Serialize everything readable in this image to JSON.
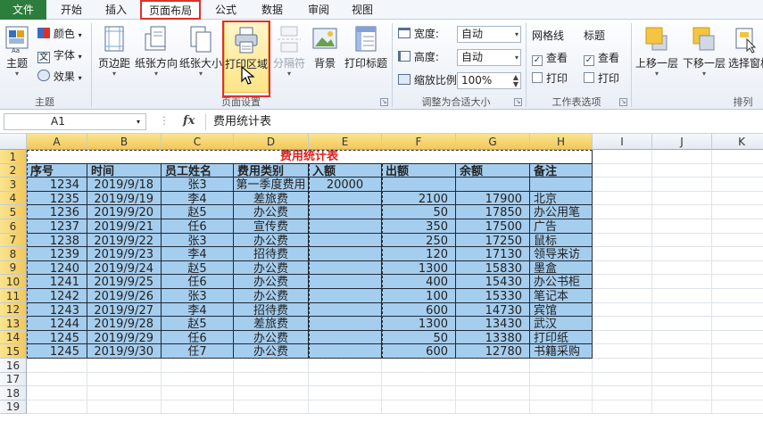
{
  "tabs": [
    {
      "label": "文件"
    },
    {
      "label": "开始"
    },
    {
      "label": "插入"
    },
    {
      "label": "页面布局"
    },
    {
      "label": "公式"
    },
    {
      "label": "数据"
    },
    {
      "label": "审阅"
    },
    {
      "label": "视图"
    }
  ],
  "ribbon": {
    "theme": {
      "theme_label": "主题",
      "colors_label": "颜色",
      "fonts_label": "字体",
      "effects_label": "效果",
      "group_label": "主题"
    },
    "page_setup": {
      "margins_label": "页边距",
      "orientation_label": "纸张方向",
      "size_label": "纸张大小",
      "print_area_label": "打印区域",
      "breaks_label": "分隔符",
      "background_label": "背景",
      "print_titles_label": "打印标题",
      "group_label": "页面设置"
    },
    "scale": {
      "width_label": "宽度:",
      "width_value": "自动",
      "height_label": "高度:",
      "height_value": "自动",
      "scale_label": "缩放比例:",
      "scale_value": "100%",
      "group_label": "调整为合适大小"
    },
    "sheet_options": {
      "gridlines_label": "网格线",
      "headings_label": "标题",
      "view_label": "查看",
      "print_label": "打印",
      "group_label": "工作表选项"
    },
    "arrange": {
      "bring_forward_label": "上移一层",
      "send_backward_label": "下移一层",
      "selection_pane_label": "选择窗格",
      "group_label": "排列"
    }
  },
  "formula_bar": {
    "name_box": "A1",
    "fx": "fx",
    "formula": "费用统计表"
  },
  "columns": [
    "A",
    "B",
    "C",
    "D",
    "E",
    "F",
    "G",
    "H",
    "I",
    "J",
    "K"
  ],
  "rows": [
    "1",
    "2",
    "3",
    "4",
    "5",
    "6",
    "7",
    "8",
    "9",
    "10",
    "11",
    "12",
    "13",
    "14",
    "15",
    "16",
    "17",
    "18",
    "19"
  ],
  "sheet": {
    "title": "费用统计表",
    "headers": [
      "序号",
      "时间",
      "员工姓名",
      "费用类别",
      "入额",
      "出额",
      "余额",
      "备注"
    ],
    "data": [
      [
        "1234",
        "2019/9/18",
        "张3",
        "第一季度费用",
        "20000",
        "",
        "",
        ""
      ],
      [
        "1235",
        "2019/9/19",
        "李4",
        "差旅费",
        "",
        "2100",
        "17900",
        "北京"
      ],
      [
        "1236",
        "2019/9/20",
        "赵5",
        "办公费",
        "",
        "50",
        "17850",
        "办公用笔"
      ],
      [
        "1237",
        "2019/9/21",
        "任6",
        "宣传费",
        "",
        "350",
        "17500",
        "广告"
      ],
      [
        "1238",
        "2019/9/22",
        "张3",
        "办公费",
        "",
        "250",
        "17250",
        "鼠标"
      ],
      [
        "1239",
        "2019/9/23",
        "李4",
        "招待费",
        "",
        "120",
        "17130",
        "领导来访"
      ],
      [
        "1240",
        "2019/9/24",
        "赵5",
        "办公费",
        "",
        "1300",
        "15830",
        "墨盒"
      ],
      [
        "1241",
        "2019/9/25",
        "任6",
        "办公费",
        "",
        "400",
        "15430",
        "办公书柜"
      ],
      [
        "1242",
        "2019/9/26",
        "张3",
        "办公费",
        "",
        "100",
        "15330",
        "笔记本"
      ],
      [
        "1243",
        "2019/9/27",
        "李4",
        "招待费",
        "",
        "600",
        "14730",
        "宾馆"
      ],
      [
        "1244",
        "2019/9/28",
        "赵5",
        "差旅费",
        "",
        "1300",
        "13430",
        "武汉"
      ],
      [
        "1245",
        "2019/9/29",
        "任6",
        "办公费",
        "",
        "50",
        "13380",
        "打印纸"
      ],
      [
        "1245",
        "2019/9/30",
        "任7",
        "办公费",
        "",
        "600",
        "12780",
        "书籍采购"
      ]
    ]
  },
  "colors": {
    "file_tab": "#2d7d3c",
    "highlight": "#e0302b",
    "cell_fill": "#a5cdee",
    "title_text": "#e0201d"
  }
}
